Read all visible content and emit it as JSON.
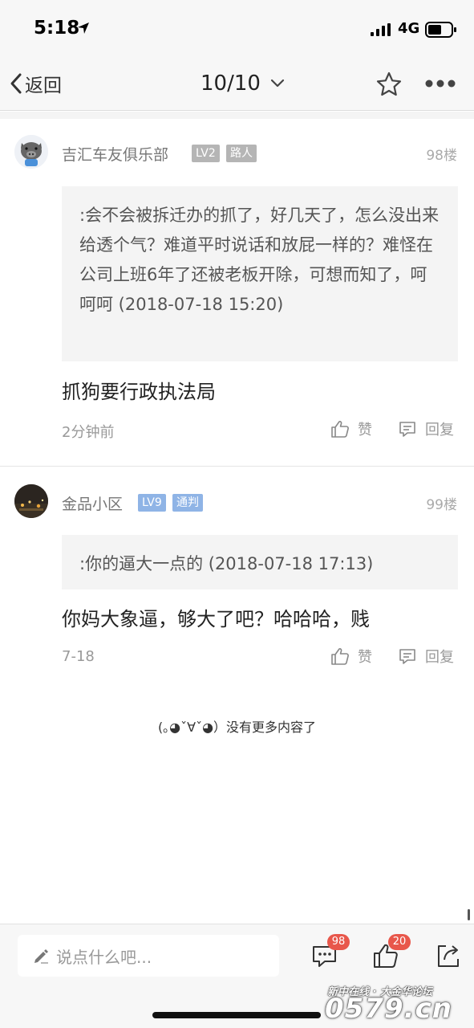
{
  "status_bar": {
    "time": "5:18",
    "network": "4G"
  },
  "nav": {
    "back_label": "返回",
    "page_indicator": "10/10"
  },
  "posts": [
    {
      "username": "吉汇车友俱乐部",
      "level": "LV2",
      "role": "路人",
      "level_color": "#b5b5b5",
      "role_color": "#b5b5b5",
      "floor": "98楼",
      "quote": ":会不会被拆迁办的抓了，好几天了，怎么没出来给透个气？难道平时说话和放屁一样的？难怪在公司上班6年了还被老板开除，可想而知了，呵呵呵 (2018-07-18 15:20)",
      "content": "抓狗要行政执法局",
      "time": "2分钟前",
      "like_label": "赞",
      "reply_label": "回复"
    },
    {
      "username": "金品小区",
      "level": "LV9",
      "role": "通判",
      "level_color": "#8fb4e6",
      "role_color": "#8fb4e6",
      "floor": "99楼",
      "quote": ":你的逼大一点的 (2018-07-18 17:13)",
      "content": "你妈大象逼，够大了吧？哈哈哈，贱",
      "time": "7-18",
      "like_label": "赞",
      "reply_label": "回复"
    }
  ],
  "no_more_text": "(｡◕ˇ∀ˇ◕）没有更多内容了",
  "bottom_bar": {
    "input_placeholder": "说点什么吧...",
    "comment_count": "98",
    "like_count": "20"
  },
  "watermark": {
    "top_line": "新中在线 · 大金华论坛",
    "main": "0579.cn"
  },
  "icons": [
    "location-arrow-icon",
    "signal-icon",
    "battery-icon",
    "back-chevron-icon",
    "chevron-down-icon",
    "star-icon",
    "more-icon",
    "thumbs-up-icon",
    "reply-icon",
    "pencil-icon",
    "comment-icon",
    "share-icon"
  ]
}
